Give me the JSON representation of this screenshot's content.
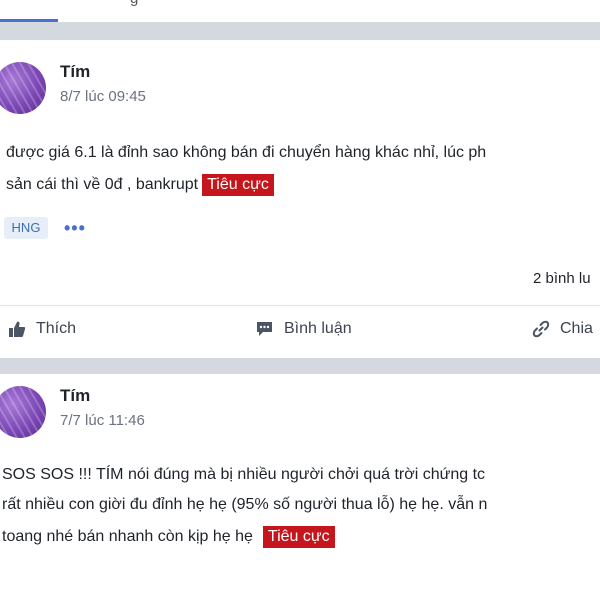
{
  "top_nav": {
    "crumb": "g"
  },
  "posts": [
    {
      "author": "Tím",
      "time": "8/7 lúc 09:45",
      "lines": [
        "được giá 6.1 là đỉnh sao không bán đi chuyển hàng khác nhỉ, lúc ph",
        "sản cái thì về 0đ , bankrupt"
      ],
      "sentiment": "Tiêu cực",
      "ticker": "HNG",
      "more": "•••",
      "comment_count": "2 bình lu",
      "actions": {
        "like": "Thích",
        "comment": "Bình luận",
        "share": "Chia"
      }
    },
    {
      "author": "Tím",
      "time": "7/7 lúc 11:46",
      "lines": [
        "SOS SOS !!! TÍM nói đúng mà bị nhiều người chởi quá trời chứng tc",
        "rất nhiều con giời đu đỉnh hẹ hẹ (95% số người thua lỗ) hẹ hẹ. vẫn n",
        "toang nhé bán nhanh còn kịp hẹ hẹ"
      ],
      "sentiment": "Tiêu cực"
    }
  ],
  "colors": {
    "sentiment_tag": "#c4161c",
    "ticker_chip_bg": "#e7eef8",
    "link": "#4a6fd1"
  }
}
